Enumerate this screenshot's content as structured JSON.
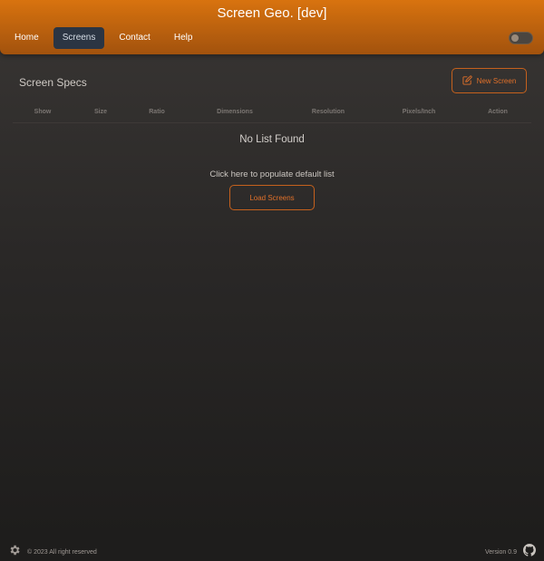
{
  "app": {
    "title": "Screen Geo. [dev]"
  },
  "nav": {
    "items": [
      {
        "label": "Home"
      },
      {
        "label": "Screens"
      },
      {
        "label": "Contact"
      },
      {
        "label": "Help"
      }
    ],
    "active": "Screens"
  },
  "main": {
    "section_title": "Screen Specs",
    "new_screen_label": "New Screen",
    "columns": [
      "Show",
      "Size",
      "Ratio",
      "Dimensions",
      "Resolution",
      "Pixels/Inch",
      "Action"
    ],
    "empty_title": "No List Found",
    "populate_text": "Click here to populate default list",
    "load_button_label": "Load Screens"
  },
  "footer": {
    "copyright": "© 2023 All right reserved",
    "version": "Version 0.9"
  },
  "icons": {
    "settings": "gear-icon",
    "github": "github-icon",
    "edit": "edit-icon"
  },
  "colors": {
    "accent": "#e0702a",
    "header_top": "#d8730f",
    "header_bottom": "#a2520d",
    "active_tab": "#2b3543"
  }
}
